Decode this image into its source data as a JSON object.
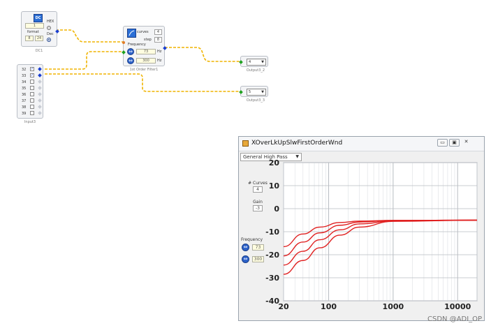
{
  "dc_block": {
    "value": "1",
    "format_label": "format",
    "f1": "8",
    "f2": "24",
    "hex_label": "HEX",
    "dec_label": "Dec",
    "caption": "DC1"
  },
  "filter_block": {
    "curves_label": "curves",
    "curves_value": "4",
    "step_label": "step",
    "step_value": "8",
    "frequency_label": "Frequency",
    "freq1": "73",
    "freq2": "300",
    "unit": "Hz",
    "caption": "1st Order Filter1"
  },
  "output2": {
    "value": "4",
    "caption": "Output3_2"
  },
  "output3": {
    "value": "5",
    "caption": "Output3_3"
  },
  "input_block": {
    "caption": "Input3",
    "rows": [
      {
        "label": "32",
        "checked": "✓"
      },
      {
        "label": "33",
        "checked": "✓"
      },
      {
        "label": "34",
        "checked": ""
      },
      {
        "label": "35",
        "checked": ""
      },
      {
        "label": "36",
        "checked": ""
      },
      {
        "label": "37",
        "checked": ""
      },
      {
        "label": "38",
        "checked": ""
      },
      {
        "label": "39",
        "checked": ""
      }
    ]
  },
  "window": {
    "title": "XOverLkUpSlwFirstOrderWnd",
    "filter_type": "General High Pass",
    "curves_label": "# Curves",
    "curves_value": "4",
    "gain_label": "Gain",
    "gain_value": "-3",
    "frequency_label": "Frequency",
    "freq1": "73",
    "freq2": "300"
  },
  "watermark": "CSDN @ADI_OP",
  "chart_data": {
    "type": "line",
    "title": "",
    "xlabel": "",
    "ylabel": "",
    "x_scale": "log",
    "xlim": [
      20,
      20000
    ],
    "ylim": [
      -40,
      20
    ],
    "x_ticks": [
      "20",
      "100",
      "1000",
      "10000"
    ],
    "y_ticks": [
      "20",
      "10",
      "0",
      "-10",
      "-20",
      "-30",
      "-40"
    ],
    "grid": true,
    "series_color": "#e02020",
    "series": [
      {
        "x": [
          20,
          40,
          73,
          150,
          300,
          1000,
          20000
        ],
        "values": [
          -16.5,
          -11,
          -8,
          -6,
          -5.4,
          -5.1,
          -5
        ]
      },
      {
        "x": [
          20,
          40,
          73,
          150,
          300,
          1000,
          20000
        ],
        "values": [
          -20.5,
          -14.5,
          -10.5,
          -7.2,
          -5.8,
          -5.1,
          -5
        ]
      },
      {
        "x": [
          20,
          40,
          73,
          150,
          300,
          1000,
          20000
        ],
        "values": [
          -24.5,
          -18.5,
          -13.5,
          -9.2,
          -6.6,
          -5.3,
          -5
        ]
      },
      {
        "x": [
          20,
          40,
          73,
          150,
          300,
          1000,
          20000
        ],
        "values": [
          -28.5,
          -22.5,
          -17,
          -11.5,
          -8,
          -5.5,
          -5
        ]
      }
    ]
  }
}
